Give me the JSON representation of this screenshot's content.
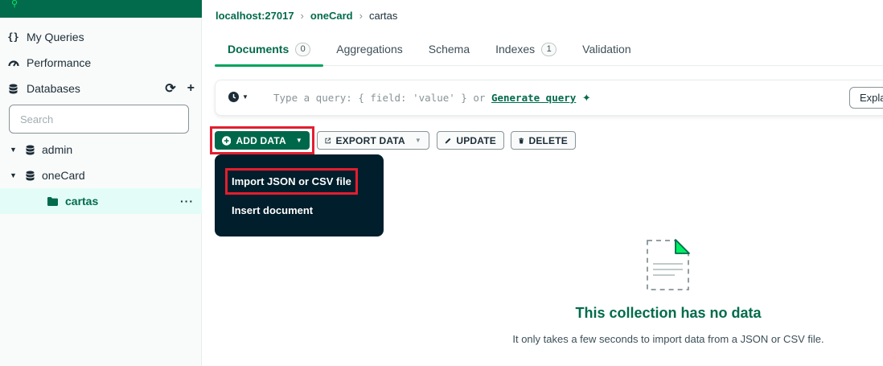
{
  "sidebar": {
    "nav": [
      {
        "label": "My Queries",
        "icon": "braces-icon"
      },
      {
        "label": "Performance",
        "icon": "gauge-icon"
      },
      {
        "label": "Databases",
        "icon": "database-icon"
      }
    ],
    "db_actions": {
      "refresh_icon": "refresh-icon",
      "add_icon": "plus-icon"
    },
    "search_placeholder": "Search",
    "tree": [
      {
        "label": "admin",
        "expanded": true
      },
      {
        "label": "oneCard",
        "expanded": true
      },
      {
        "label": "cartas",
        "selected": true,
        "more": "···"
      }
    ]
  },
  "breadcrumb": [
    "localhost:27017",
    "oneCard",
    "cartas"
  ],
  "tabs": [
    {
      "label": "Documents",
      "count": "0",
      "active": true
    },
    {
      "label": "Aggregations"
    },
    {
      "label": "Schema"
    },
    {
      "label": "Indexes",
      "count": "1"
    },
    {
      "label": "Validation"
    }
  ],
  "query": {
    "placeholder": "Type a query: { field: 'value' } or",
    "generate_link": "Generate query",
    "sparkle": "✦",
    "explain_label": "Explain"
  },
  "toolbar": {
    "add_data": "ADD DATA",
    "export_data": "EXPORT DATA",
    "update": "UPDATE",
    "delete": "DELETE"
  },
  "add_data_menu": {
    "import": "Import JSON or CSV file",
    "insert": "Insert document"
  },
  "empty_state": {
    "title": "This collection has no data",
    "description": "It only takes a few seconds to import data from a JSON or CSV file."
  },
  "colors": {
    "brand_green": "#00684a",
    "text_green": "#016b4b",
    "menu_bg": "#001e2b",
    "highlight_red": "#e21e2e",
    "selected_bg": "#e3fcf7"
  }
}
